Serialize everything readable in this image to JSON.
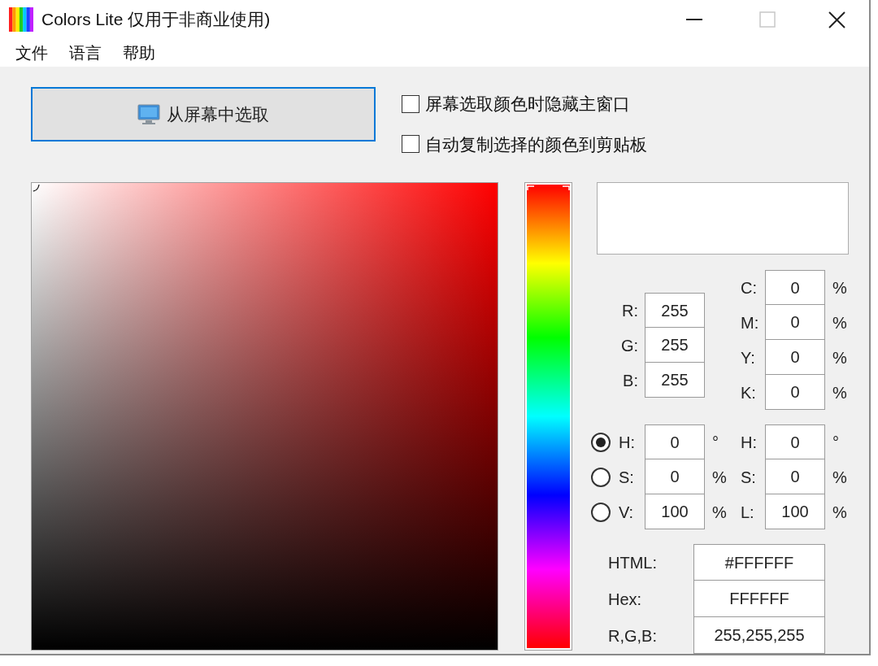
{
  "window": {
    "title": "Colors Lite 仅用于非商业使用)"
  },
  "menu": [
    {
      "label": "文件"
    },
    {
      "label": "语言"
    },
    {
      "label": "帮助"
    }
  ],
  "pick_button": {
    "label": "从屏幕中选取",
    "focused": true
  },
  "options": [
    {
      "label": "屏幕选取颜色时隐藏主窗口",
      "checked": false
    },
    {
      "label": "自动复制选择的颜色到剪贴板",
      "checked": false
    }
  ],
  "hue_slider": {
    "level": 1
  },
  "preview": {
    "color": "#ffffff"
  },
  "rgb": [
    {
      "label": "R:",
      "value": "255"
    },
    {
      "label": "G:",
      "value": "255"
    },
    {
      "label": "B:",
      "value": "255"
    }
  ],
  "cmyk": [
    {
      "label": "C:",
      "value": "0",
      "unit": "%"
    },
    {
      "label": "M:",
      "value": "0",
      "unit": "%"
    },
    {
      "label": "Y:",
      "value": "0",
      "unit": "%"
    },
    {
      "label": "K:",
      "value": "0",
      "unit": "%"
    }
  ],
  "hsv": [
    {
      "label": "H:",
      "value": "0",
      "unit": "°",
      "selected": true
    },
    {
      "label": "S:",
      "value": "0",
      "unit": "%",
      "selected": false
    },
    {
      "label": "V:",
      "value": "100",
      "unit": "%",
      "selected": false
    }
  ],
  "hsl": [
    {
      "label": "H:",
      "value": "0",
      "unit": "°"
    },
    {
      "label": "S:",
      "value": "0",
      "unit": "%"
    },
    {
      "label": "L:",
      "value": "100",
      "unit": "%"
    }
  ],
  "codes": [
    {
      "label": "HTML:",
      "value": "#FFFFFF"
    },
    {
      "label": "Hex:",
      "value": "FFFFFF"
    },
    {
      "label": "R,G,B:",
      "value": "255,255,255"
    }
  ]
}
